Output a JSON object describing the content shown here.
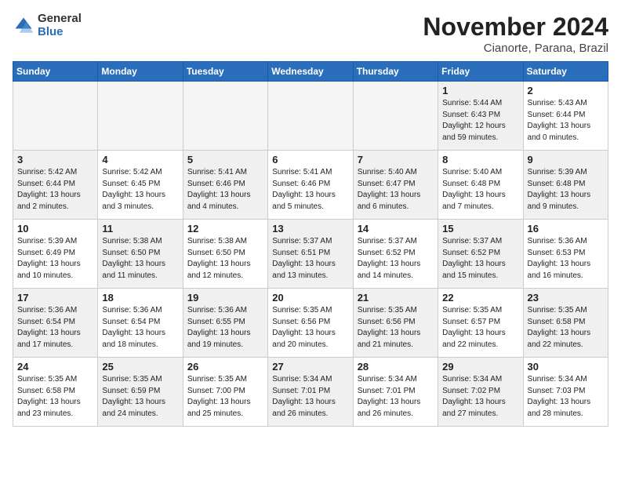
{
  "logo": {
    "general": "General",
    "blue": "Blue"
  },
  "title": "November 2024",
  "location": "Cianorte, Parana, Brazil",
  "weekdays": [
    "Sunday",
    "Monday",
    "Tuesday",
    "Wednesday",
    "Thursday",
    "Friday",
    "Saturday"
  ],
  "weeks": [
    [
      {
        "day": "",
        "info": ""
      },
      {
        "day": "",
        "info": ""
      },
      {
        "day": "",
        "info": ""
      },
      {
        "day": "",
        "info": ""
      },
      {
        "day": "",
        "info": ""
      },
      {
        "day": "1",
        "info": "Sunrise: 5:44 AM\nSunset: 6:43 PM\nDaylight: 12 hours\nand 59 minutes."
      },
      {
        "day": "2",
        "info": "Sunrise: 5:43 AM\nSunset: 6:44 PM\nDaylight: 13 hours\nand 0 minutes."
      }
    ],
    [
      {
        "day": "3",
        "info": "Sunrise: 5:42 AM\nSunset: 6:44 PM\nDaylight: 13 hours\nand 2 minutes."
      },
      {
        "day": "4",
        "info": "Sunrise: 5:42 AM\nSunset: 6:45 PM\nDaylight: 13 hours\nand 3 minutes."
      },
      {
        "day": "5",
        "info": "Sunrise: 5:41 AM\nSunset: 6:46 PM\nDaylight: 13 hours\nand 4 minutes."
      },
      {
        "day": "6",
        "info": "Sunrise: 5:41 AM\nSunset: 6:46 PM\nDaylight: 13 hours\nand 5 minutes."
      },
      {
        "day": "7",
        "info": "Sunrise: 5:40 AM\nSunset: 6:47 PM\nDaylight: 13 hours\nand 6 minutes."
      },
      {
        "day": "8",
        "info": "Sunrise: 5:40 AM\nSunset: 6:48 PM\nDaylight: 13 hours\nand 7 minutes."
      },
      {
        "day": "9",
        "info": "Sunrise: 5:39 AM\nSunset: 6:48 PM\nDaylight: 13 hours\nand 9 minutes."
      }
    ],
    [
      {
        "day": "10",
        "info": "Sunrise: 5:39 AM\nSunset: 6:49 PM\nDaylight: 13 hours\nand 10 minutes."
      },
      {
        "day": "11",
        "info": "Sunrise: 5:38 AM\nSunset: 6:50 PM\nDaylight: 13 hours\nand 11 minutes."
      },
      {
        "day": "12",
        "info": "Sunrise: 5:38 AM\nSunset: 6:50 PM\nDaylight: 13 hours\nand 12 minutes."
      },
      {
        "day": "13",
        "info": "Sunrise: 5:37 AM\nSunset: 6:51 PM\nDaylight: 13 hours\nand 13 minutes."
      },
      {
        "day": "14",
        "info": "Sunrise: 5:37 AM\nSunset: 6:52 PM\nDaylight: 13 hours\nand 14 minutes."
      },
      {
        "day": "15",
        "info": "Sunrise: 5:37 AM\nSunset: 6:52 PM\nDaylight: 13 hours\nand 15 minutes."
      },
      {
        "day": "16",
        "info": "Sunrise: 5:36 AM\nSunset: 6:53 PM\nDaylight: 13 hours\nand 16 minutes."
      }
    ],
    [
      {
        "day": "17",
        "info": "Sunrise: 5:36 AM\nSunset: 6:54 PM\nDaylight: 13 hours\nand 17 minutes."
      },
      {
        "day": "18",
        "info": "Sunrise: 5:36 AM\nSunset: 6:54 PM\nDaylight: 13 hours\nand 18 minutes."
      },
      {
        "day": "19",
        "info": "Sunrise: 5:36 AM\nSunset: 6:55 PM\nDaylight: 13 hours\nand 19 minutes."
      },
      {
        "day": "20",
        "info": "Sunrise: 5:35 AM\nSunset: 6:56 PM\nDaylight: 13 hours\nand 20 minutes."
      },
      {
        "day": "21",
        "info": "Sunrise: 5:35 AM\nSunset: 6:56 PM\nDaylight: 13 hours\nand 21 minutes."
      },
      {
        "day": "22",
        "info": "Sunrise: 5:35 AM\nSunset: 6:57 PM\nDaylight: 13 hours\nand 22 minutes."
      },
      {
        "day": "23",
        "info": "Sunrise: 5:35 AM\nSunset: 6:58 PM\nDaylight: 13 hours\nand 22 minutes."
      }
    ],
    [
      {
        "day": "24",
        "info": "Sunrise: 5:35 AM\nSunset: 6:58 PM\nDaylight: 13 hours\nand 23 minutes."
      },
      {
        "day": "25",
        "info": "Sunrise: 5:35 AM\nSunset: 6:59 PM\nDaylight: 13 hours\nand 24 minutes."
      },
      {
        "day": "26",
        "info": "Sunrise: 5:35 AM\nSunset: 7:00 PM\nDaylight: 13 hours\nand 25 minutes."
      },
      {
        "day": "27",
        "info": "Sunrise: 5:34 AM\nSunset: 7:01 PM\nDaylight: 13 hours\nand 26 minutes."
      },
      {
        "day": "28",
        "info": "Sunrise: 5:34 AM\nSunset: 7:01 PM\nDaylight: 13 hours\nand 26 minutes."
      },
      {
        "day": "29",
        "info": "Sunrise: 5:34 AM\nSunset: 7:02 PM\nDaylight: 13 hours\nand 27 minutes."
      },
      {
        "day": "30",
        "info": "Sunrise: 5:34 AM\nSunset: 7:03 PM\nDaylight: 13 hours\nand 28 minutes."
      }
    ]
  ]
}
